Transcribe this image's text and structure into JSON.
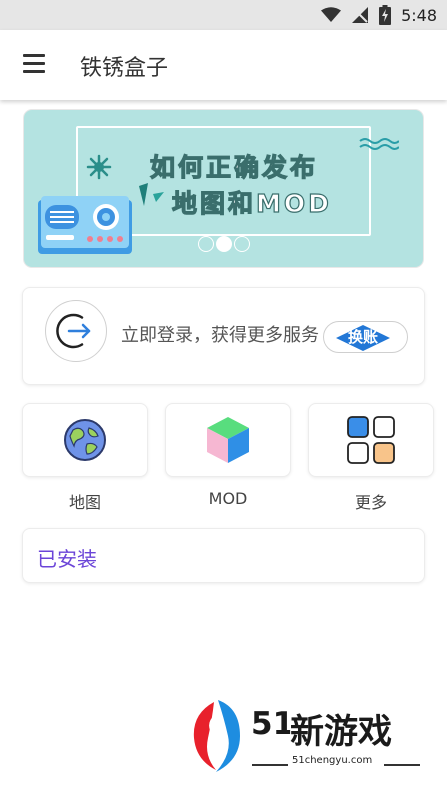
{
  "status_bar": {
    "time": "5:48"
  },
  "app_bar": {
    "title": "铁锈盒子"
  },
  "banner": {
    "line1": "如何正确发布",
    "line2": "地图和MOD",
    "page_count": 3,
    "active_page": 2
  },
  "login": {
    "prompt": "立即登录，获得更多服务",
    "switch_label": "换账"
  },
  "grid": {
    "items": [
      {
        "label": "地图",
        "icon": "globe-icon"
      },
      {
        "label": "MOD",
        "icon": "cube-icon"
      },
      {
        "label": "更多",
        "icon": "apps-grid-icon"
      }
    ]
  },
  "installed": {
    "label": "已安装"
  },
  "watermark": {
    "number": "51",
    "chinese": "新游戏",
    "url": "51chengyu.com"
  },
  "colors": {
    "accent_purple": "#6b45d8",
    "banner_bg": "#b4e3e1",
    "switch_blue": "#2277d6"
  }
}
